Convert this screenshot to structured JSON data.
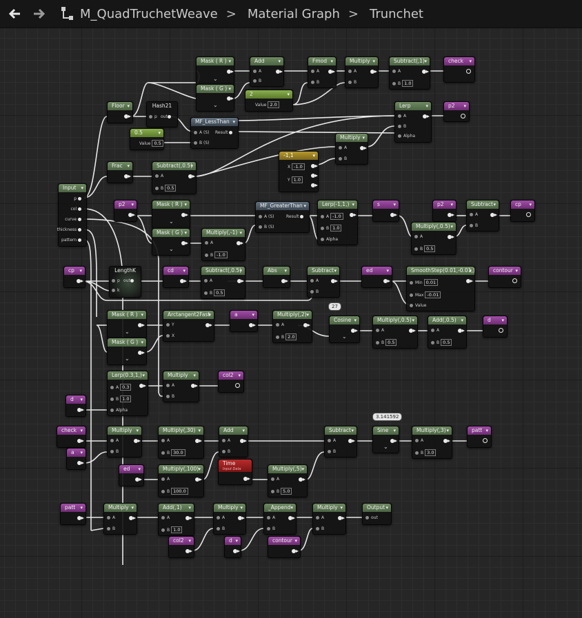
{
  "header": {
    "back_icon": "back-arrow-icon",
    "forward_icon": "forward-arrow-icon",
    "hierarchy_icon": "tree-hierarchy-icon",
    "breadcrumbs": [
      "M_QuadTruchetWeave",
      "Material Graph",
      "Trunchet"
    ],
    "separator": ">"
  },
  "nodes": {
    "mask_r_1": {
      "title": "Mask ( R )"
    },
    "mask_g_1": {
      "title": "Mask ( G )"
    },
    "add_1": {
      "title": "Add",
      "a": "A",
      "b": "B"
    },
    "fmod": {
      "title": "Fmod",
      "a": "A",
      "b": "B"
    },
    "multiply_1": {
      "title": "Multiply",
      "a": "A",
      "b": "B"
    },
    "subtract_1": {
      "title": "Subtract(,1)",
      "a": "A",
      "b": "B",
      "b_val": "1.0"
    },
    "var_check_out": {
      "title": "check"
    },
    "floor": {
      "title": "Floor"
    },
    "hash21": {
      "title": "Hash21",
      "p": "p",
      "out": "out"
    },
    "const_2": {
      "title": "2",
      "value_label": "Value",
      "value": "2.0"
    },
    "mf_lessthan": {
      "title": "MF_LessThan",
      "a": "A (S)",
      "b": "B (S)",
      "result": "Result"
    },
    "const_05": {
      "title": "0.5",
      "value_label": "Value",
      "value": "0.5"
    },
    "lerp_1": {
      "title": "Lerp",
      "a": "A",
      "b": "B",
      "alpha": "Alpha"
    },
    "var_p2_out": {
      "title": "p2"
    },
    "multiply_2": {
      "title": "Multiply",
      "a": "A",
      "b": "B"
    },
    "frac": {
      "title": "Frac"
    },
    "subtract_05": {
      "title": "Subtract(,0.5)",
      "a": "A",
      "b": "B",
      "b_val": "0.5"
    },
    "vec_m11": {
      "title": "-1,1",
      "x": "X",
      "x_val": "-1.0",
      "y": "Y",
      "y_val": "1.0"
    },
    "input": {
      "title": "Input",
      "pins": [
        "p",
        "col",
        "curve",
        "thickness",
        "pattern"
      ]
    },
    "var_p2_a": {
      "title": "p2"
    },
    "mask_r_2": {
      "title": "Mask ( R )"
    },
    "mask_g_2": {
      "title": "Mask ( G )"
    },
    "multiply_m1": {
      "title": "Multiply(,-1)",
      "a": "A",
      "b": "B",
      "b_val": "-1.0"
    },
    "mf_greaterthan": {
      "title": "MF_GreaterThan",
      "a": "A (S)",
      "b": "B (S)",
      "result": "Result"
    },
    "lerp_m11": {
      "title": "Lerp(-1,1,)",
      "a": "A",
      "a_val": "-1.0",
      "b": "B",
      "b_val": "1.0",
      "alpha": "Alpha"
    },
    "var_s": {
      "title": "s"
    },
    "var_p2_b": {
      "title": "p2"
    },
    "subtract_2": {
      "title": "Subtract",
      "a": "A",
      "b": "B"
    },
    "var_cp_out": {
      "title": "cp"
    },
    "multiply_05_a": {
      "title": "Multiply(,0.5)",
      "a": "A",
      "b": "B",
      "b_val": "0.5"
    },
    "var_cp_in": {
      "title": "cp"
    },
    "lengthk": {
      "title": "LengthK",
      "p": "p",
      "k": "k",
      "out": "out"
    },
    "var_cd_in": {
      "title": "cd"
    },
    "subtract_05_b": {
      "title": "Subtract(,0.5)",
      "a": "A",
      "b": "B",
      "b_val": "0.5"
    },
    "abs": {
      "title": "Abs"
    },
    "subtract_3": {
      "title": "Subtract",
      "a": "A",
      "b": "B"
    },
    "var_ed": {
      "title": "ed"
    },
    "smoothstep": {
      "title": "SmoothStep(0.01,-0.01,)",
      "min": "Min",
      "min_val": "0.01",
      "max": "Max",
      "max_val": "-0.01",
      "value": "Value"
    },
    "var_contour_out": {
      "title": "contour"
    },
    "comment_27": {
      "text": "27"
    },
    "mask_r_3": {
      "title": "Mask ( R )"
    },
    "mask_g_3": {
      "title": "Mask ( G )"
    },
    "arctangent": {
      "title": "Arctangent2Fast",
      "y": "Y",
      "x": "X"
    },
    "var_a_out": {
      "title": "a"
    },
    "multiply_2x": {
      "title": "Multiply(,2)",
      "a": "A",
      "b": "B",
      "b_val": "2.0"
    },
    "cosine": {
      "title": "Cosine"
    },
    "multiply_05_b": {
      "title": "Multiply(,0.5)",
      "a": "A",
      "b": "B",
      "b_val": "0.5"
    },
    "add_05": {
      "title": "Add(,0.5)",
      "a": "A",
      "b": "B",
      "b_val": "0.5"
    },
    "var_d_out": {
      "title": "d"
    },
    "lerp_03_1": {
      "title": "Lerp(0.3,1,)",
      "a": "A",
      "a_val": "0.3",
      "b": "B",
      "b_val": "1.0",
      "alpha": "Alpha"
    },
    "multiply_3": {
      "title": "Multiply",
      "a": "A",
      "b": "B"
    },
    "var_col2_out": {
      "title": "col2"
    },
    "var_d_in": {
      "title": "d"
    },
    "comment_pi": {
      "text": "3.141592"
    },
    "var_check_in": {
      "title": "check"
    },
    "multiply_4": {
      "title": "Multiply",
      "a": "A",
      "b": "B"
    },
    "multiply_30": {
      "title": "Multiply(,30)",
      "a": "A",
      "b": "B",
      "b_val": "30.0"
    },
    "add_2": {
      "title": "Add",
      "a": "A",
      "b": "B"
    },
    "subtract_4": {
      "title": "Subtract",
      "a": "A",
      "b": "B"
    },
    "sine": {
      "title": "Sine"
    },
    "multiply_3x": {
      "title": "Multiply(,3)",
      "a": "A",
      "b": "B",
      "b_val": "3.0"
    },
    "var_patt_out": {
      "title": "patt"
    },
    "var_a_in": {
      "title": "a"
    },
    "var_ed_in": {
      "title": "ed"
    },
    "multiply_100": {
      "title": "Multiply(,100)",
      "a": "A",
      "b": "B",
      "b_val": "100.0"
    },
    "time": {
      "title": "Time",
      "subtitle": "Input Data"
    },
    "multiply_5": {
      "title": "Multiply(,5)",
      "a": "A",
      "b": "B",
      "b_val": "5.0"
    },
    "var_patt_in": {
      "title": "patt"
    },
    "multiply_5b": {
      "title": "Multiply",
      "a": "A",
      "b": "B"
    },
    "add_1b": {
      "title": "Add(,1)",
      "a": "A",
      "b": "B",
      "b_val": "1.0"
    },
    "multiply_6": {
      "title": "Multiply",
      "a": "A",
      "b": "B"
    },
    "append": {
      "title": "_Append",
      "a": "A",
      "b": "B"
    },
    "multiply_7": {
      "title": "Multiply",
      "a": "A",
      "b": "B"
    },
    "output": {
      "title": "Output",
      "out": "out"
    },
    "var_col2_in": {
      "title": "col2"
    },
    "var_d_in2": {
      "title": "d"
    },
    "var_contour_in": {
      "title": "contour"
    }
  }
}
